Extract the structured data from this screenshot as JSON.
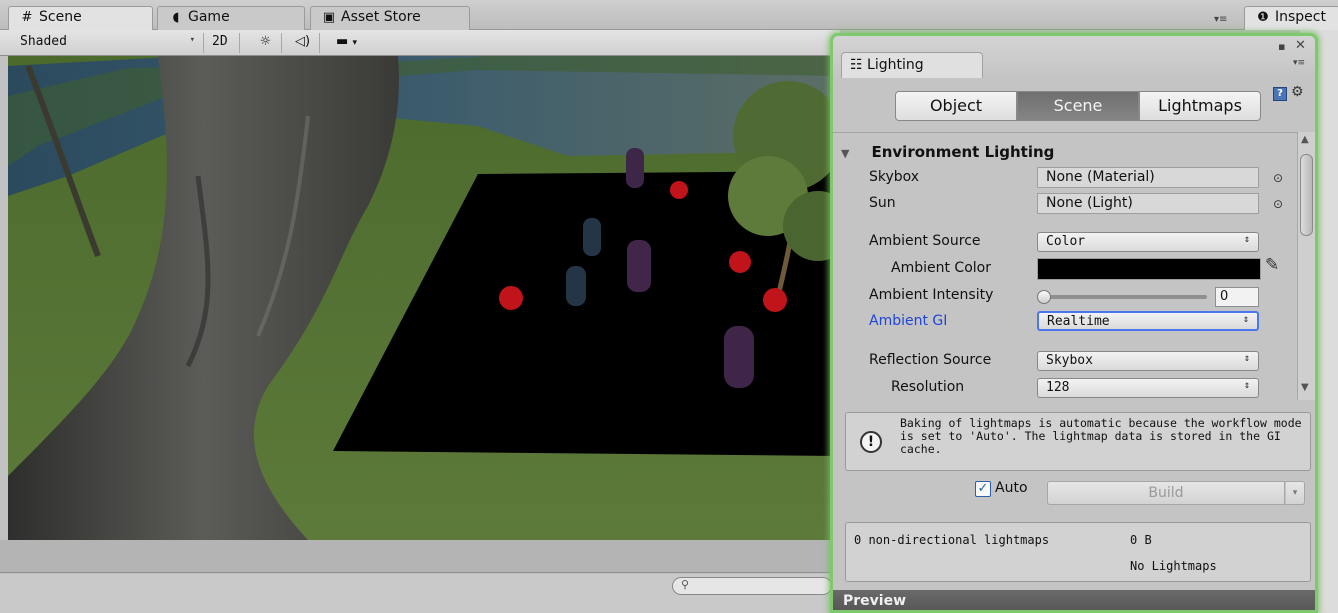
{
  "tabs": {
    "scene": "Scene",
    "game": "Game",
    "asset_store": "Asset Store",
    "inspector": "Inspect"
  },
  "toolbar": {
    "shading_mode": "Shaded",
    "two_d": "2D"
  },
  "lighting": {
    "window_title": "Lighting",
    "mode_tabs": [
      "Object",
      "Scene",
      "Lightmaps"
    ],
    "selected_tab": "Scene",
    "section": "Environment Lighting",
    "skybox": {
      "label": "Skybox",
      "value": "None (Material)"
    },
    "sun": {
      "label": "Sun",
      "value": "None (Light)"
    },
    "ambient_source": {
      "label": "Ambient Source",
      "value": "Color"
    },
    "ambient_color": {
      "label": "Ambient Color",
      "value": "#000000"
    },
    "ambient_intensity": {
      "label": "Ambient Intensity",
      "value": "0"
    },
    "ambient_gi": {
      "label": "Ambient GI",
      "value": "Realtime"
    },
    "reflection_source": {
      "label": "Reflection Source",
      "value": "Skybox"
    },
    "resolution": {
      "label": "Resolution",
      "value": "128"
    },
    "info_message": "Baking of lightmaps is automatic because the workflow mode is set to 'Auto'. The lightmap data is stored in the GI cache.",
    "auto_label": "Auto",
    "auto_checked": true,
    "build_label": "Build",
    "stats": {
      "lightmaps": "0 non-directional lightmaps",
      "size": "0 B",
      "count": "No Lightmaps"
    },
    "preview_label": "Preview"
  },
  "icons": {
    "scene_tab": "grid-icon",
    "game_tab": "pacman-icon",
    "asset_store_tab": "shopping-bag-icon",
    "inspector_tab": "info-icon",
    "lighting_tab": "sliders-icon"
  },
  "colors": {
    "accent_focus": "#4a77f0",
    "window_glow": "#7ec86e",
    "label_blue": "#1e46d8"
  }
}
